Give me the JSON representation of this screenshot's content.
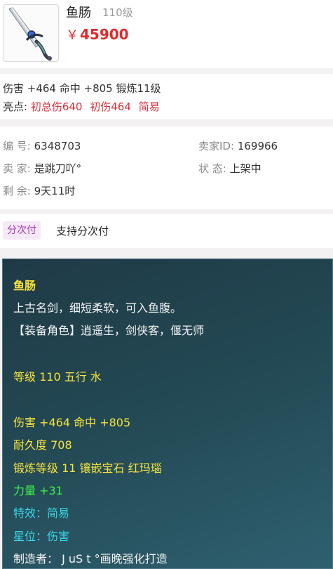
{
  "item": {
    "name": "鱼肠",
    "level": "110级",
    "currency_symbol": "￥",
    "price": "45900"
  },
  "stats": {
    "line": "伤害 +464 命中 +805 锻炼11级",
    "highlights_label": "亮点:",
    "highlights": [
      "初总伤640",
      "初伤464",
      "简易"
    ]
  },
  "info": {
    "serial_label": "编 号:",
    "serial_value": "6348703",
    "seller_id_label": "卖家ID:",
    "seller_id_value": "169966",
    "seller_label": "卖 家:",
    "seller_value": "是跳刀吖°",
    "status_label": "状 态:",
    "status_value": "上架中",
    "remaining_label": "剩 余:",
    "remaining_value": "9天11时"
  },
  "payment": {
    "badge": "分次付",
    "text": "支持分次付"
  },
  "tooltip": {
    "title": "鱼肠",
    "desc": "上古名剑，细短柔软，可入鱼腹。",
    "roles": "【装备角色】逍遥生，剑侠客，偃无师",
    "level_element": "等级 110 五行 水",
    "damage_hit": "伤害 +464 命中 +805",
    "durability": "耐久度 708",
    "forge_gem": "锻炼等级 11 镶嵌宝石 红玛瑙",
    "strength": "力量 +31",
    "special_effect": "特效：简易",
    "star": "星位：伤害",
    "maker": "制造者： J uS t °画晚强化打造"
  }
}
